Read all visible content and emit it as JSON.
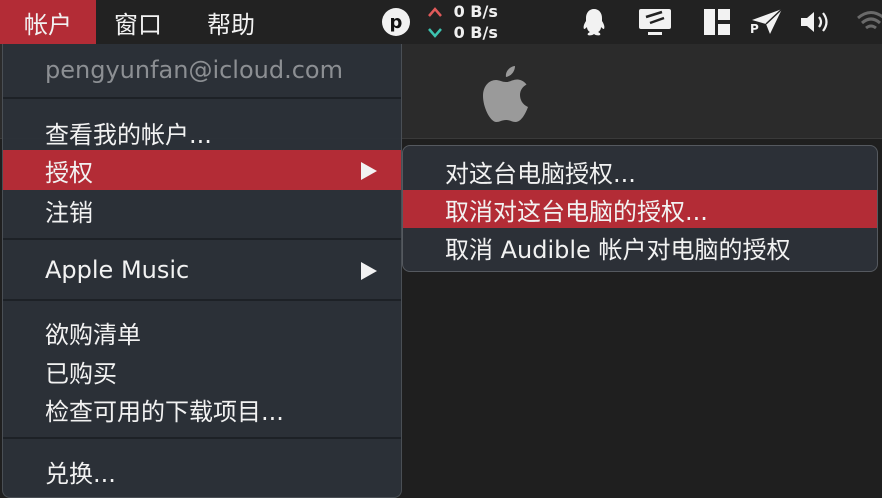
{
  "menubar": {
    "items": [
      "帐户",
      "窗口",
      "帮助"
    ],
    "status_p": "p",
    "net_up": "0 B/s",
    "net_down": "0 B/s",
    "arrow_up": "^",
    "arrow_down": "v",
    "tray_icons": [
      "qq-penguin-icon",
      "screen-cast-icon",
      "app-layout-icon",
      "send-plane-icon",
      "volume-icon",
      "wifi-icon"
    ],
    "send_label": "P"
  },
  "account_menu": {
    "email": "pengyunfan@icloud.com",
    "view_account": "查看我的帐户...",
    "authorizations": "授权",
    "sign_out": "注销",
    "apple_music": "Apple Music",
    "wish_list": "欲购清单",
    "purchased": "已购买",
    "check_downloads": "检查可用的下载项目...",
    "redeem": "兑换..."
  },
  "authorizations_submenu": {
    "authorize": "对这台电脑授权...",
    "deauthorize": "取消对这台电脑的授权...",
    "deauthorize_audible": "取消 Audible 帐户对电脑的授权"
  },
  "colors": {
    "highlight": "#b32c36",
    "menu_bg": "#2c3138",
    "menubar_bg": "#222222"
  }
}
